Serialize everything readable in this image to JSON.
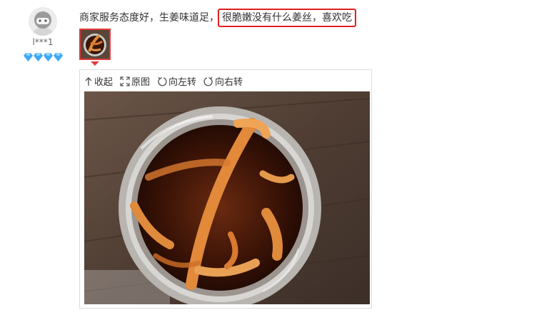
{
  "user": {
    "name": "l***1",
    "vip_level": 4,
    "vip_color": "#3fa9f5"
  },
  "review": {
    "text_plain": "商家服务态度好，生姜味道足，",
    "text_highlight": "很脆嫩没有什么姜丝，喜欢吃",
    "highlight_color": "#e02020"
  },
  "viewer": {
    "collapse_label": "收起",
    "original_label": "原图",
    "rotate_left_label": "向左转",
    "rotate_right_label": "向右转",
    "accent_color": "#e4393c"
  }
}
